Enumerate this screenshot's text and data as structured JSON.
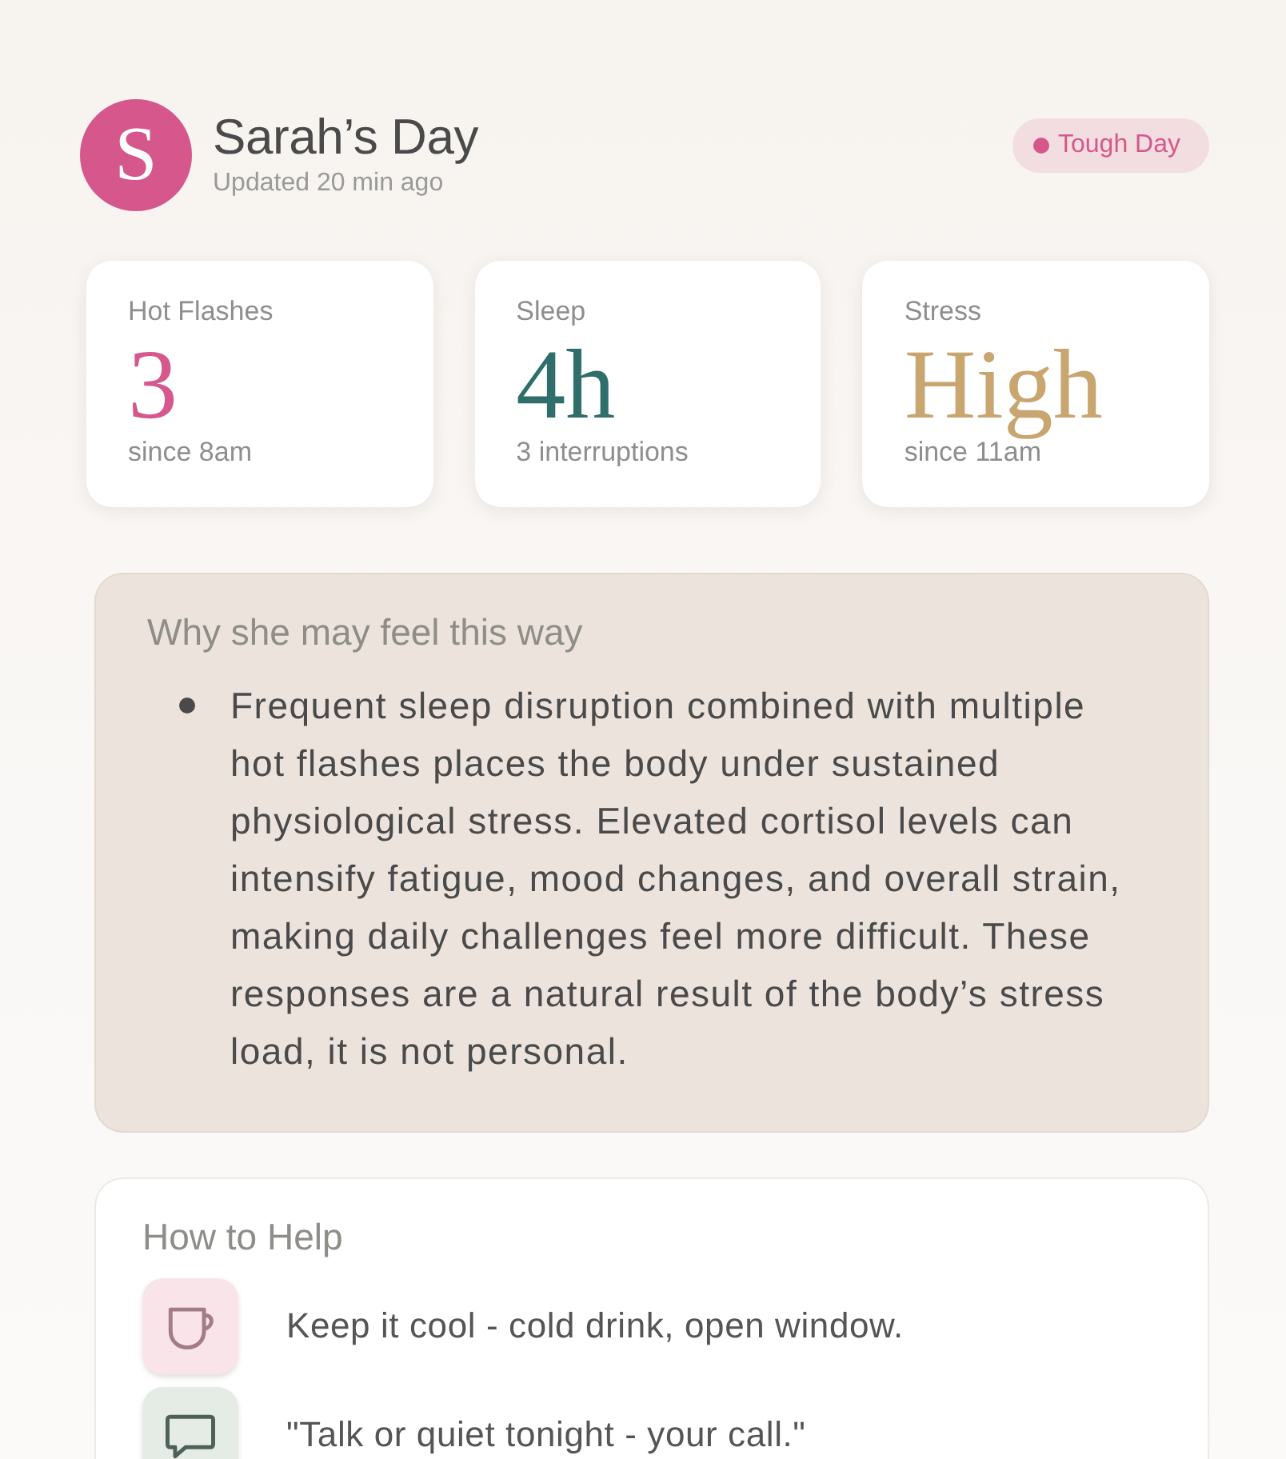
{
  "header": {
    "avatar_initial": "S",
    "title": "Sarah’s Day",
    "updated": "Updated 20 min ago",
    "status": {
      "label": "Tough Day"
    }
  },
  "stats": [
    {
      "label": "Hot Flashes",
      "value": "3",
      "detail": "since 8am",
      "color": "#d6578c"
    },
    {
      "label": "Sleep",
      "value": "4h",
      "detail": "3 interruptions",
      "color": "#2f6e6a"
    },
    {
      "label": "Stress",
      "value": "High",
      "detail": "since 11am",
      "color": "#c9a56f"
    }
  ],
  "why": {
    "title": "Why she may feel this way",
    "points": [
      "Frequent sleep disruption combined with multiple hot flashes places the body under sustained physiological stress. Elevated cortisol levels can intensify fatigue, mood changes, and overall strain, making daily challenges feel more difficult. These responses are a natural result of the body’s stress load, it is not personal."
    ]
  },
  "help": {
    "title": "How to Help",
    "items": [
      {
        "kind": "drink",
        "text": "Keep it cool - cold drink, open window."
      },
      {
        "kind": "talk",
        "text": "\"Talk or quiet tonight - your call.\""
      }
    ]
  }
}
